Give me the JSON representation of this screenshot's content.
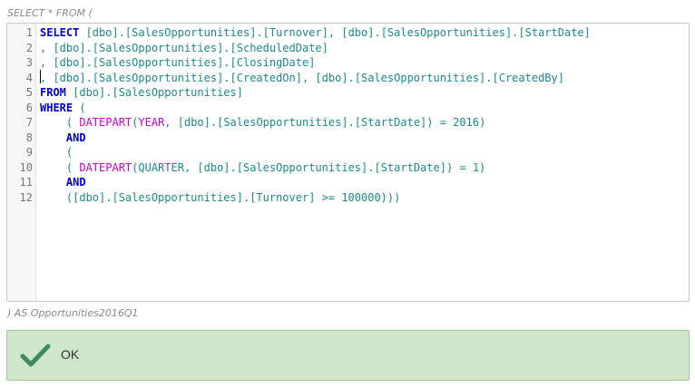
{
  "dialog": {
    "prefix_text": "SELECT * FROM (",
    "suffix_text": ") AS Opportunities2016Q1",
    "ok_label": "OK"
  },
  "colors": {
    "keyword": "#0000c8",
    "function": "#cc00cc",
    "identifier": "#1a8a8a",
    "ok_background": "#cfe6ca",
    "ok_check": "#3d8a5a"
  },
  "icons": {
    "ok": "checkmark-icon"
  },
  "editor": {
    "language": "sql",
    "lines": [
      {
        "number": "1",
        "tokens": [
          {
            "type": "keyword",
            "text": "SELECT"
          },
          {
            "type": "ident",
            "text": " [dbo].[SalesOpportunities].[Turnover], [dbo].[SalesOpportunities].[StartDate]"
          }
        ]
      },
      {
        "number": "2",
        "tokens": [
          {
            "type": "ident",
            "text": ", [dbo].[SalesOpportunities].[ScheduledDate]"
          }
        ]
      },
      {
        "number": "3",
        "tokens": [
          {
            "type": "ident",
            "text": ", [dbo].[SalesOpportunities].[ClosingDate]"
          }
        ]
      },
      {
        "number": "4",
        "tokens": [
          {
            "type": "ident",
            "text": ", [dbo].[SalesOpportunities].[CreatedOn], [dbo].[SalesOpportunities].[CreatedBy]"
          }
        ]
      },
      {
        "number": "5",
        "tokens": [
          {
            "type": "keyword",
            "text": "FROM"
          },
          {
            "type": "ident",
            "text": " [dbo].[SalesOpportunities]"
          }
        ]
      },
      {
        "number": "6",
        "tokens": [
          {
            "type": "keyword",
            "text": "WHERE"
          },
          {
            "type": "ident",
            "text": " ("
          }
        ]
      },
      {
        "number": "7",
        "tokens": [
          {
            "type": "ident",
            "text": "    ( "
          },
          {
            "type": "function",
            "text": "DATEPART"
          },
          {
            "type": "ident",
            "text": "("
          },
          {
            "type": "function",
            "text": "YEAR"
          },
          {
            "type": "ident",
            "text": ", [dbo].[SalesOpportunities].[StartDate]) = 2016)"
          }
        ]
      },
      {
        "number": "8",
        "tokens": [
          {
            "type": "ident",
            "text": "    "
          },
          {
            "type": "keyword",
            "text": "AND"
          }
        ]
      },
      {
        "number": "9",
        "tokens": [
          {
            "type": "ident",
            "text": "    ("
          }
        ]
      },
      {
        "number": "10",
        "tokens": [
          {
            "type": "ident",
            "text": "    ( "
          },
          {
            "type": "function",
            "text": "DATEPART"
          },
          {
            "type": "ident",
            "text": "(QUARTER, [dbo].[SalesOpportunities].[StartDate]) = 1)"
          }
        ]
      },
      {
        "number": "11",
        "tokens": [
          {
            "type": "ident",
            "text": "    "
          },
          {
            "type": "keyword",
            "text": "AND"
          }
        ]
      },
      {
        "number": "12",
        "tokens": [
          {
            "type": "ident",
            "text": "    ([dbo].[SalesOpportunities].[Turnover] >= 100000)))"
          }
        ]
      }
    ]
  }
}
